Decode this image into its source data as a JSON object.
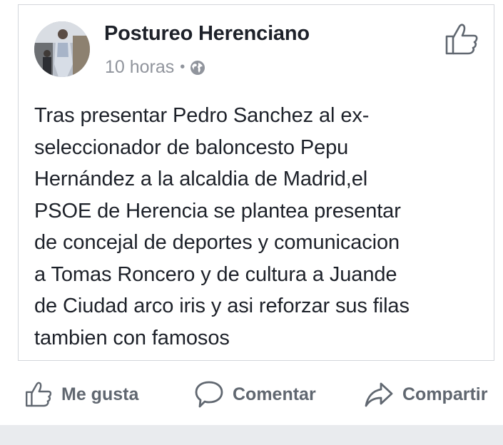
{
  "post": {
    "author": "Postureo Herenciano",
    "timestamp": "10 horas",
    "separator": "•",
    "privacy_icon": "globe-icon",
    "text": "Tras presentar Pedro Sanchez al ex-\nseleccionador de baloncesto Pepu\nHernández a la alcaldia de Madrid,el\nPSOE de Herencia se plantea presentar\nde concejal de deportes y comunicacion\na Tomas Roncero y de cultura a Juande\nde Ciudad arco iris y asi reforzar sus filas\ntambien con famosos"
  },
  "actions": {
    "like_label": "Me gusta",
    "comment_label": "Comentar",
    "share_label": "Compartir"
  },
  "colors": {
    "text_primary": "#1d2129",
    "text_secondary": "#90949c",
    "action_text": "#606770",
    "border": "#d3d6db",
    "footer_bg": "#e9ebee"
  }
}
